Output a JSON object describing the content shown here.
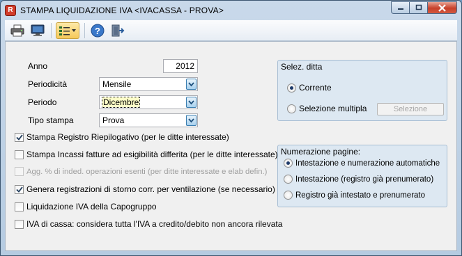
{
  "window": {
    "title": "STAMPA LIQUIDAZIONE IVA <IVACASSA - PROVA>",
    "app_icon_letter": "R"
  },
  "toolbar": {
    "buttons": [
      "printer-icon",
      "monitor-icon",
      "list-options-icon",
      "help-icon",
      "exit-door-icon"
    ]
  },
  "form": {
    "anno_label": "Anno",
    "anno_value": "2012",
    "periodicita_label": "Periodicità",
    "periodicita_value": "Mensile",
    "periodo_label": "Periodo",
    "periodo_value": "Dicembre",
    "tipo_stampa_label": "Tipo stampa",
    "tipo_stampa_value": "Prova"
  },
  "options": [
    {
      "label": "Stampa Registro Riepilogativo (per le ditte interessate)",
      "checked": true,
      "enabled": true
    },
    {
      "label": "Stampa Incassi fatture ad esigibilità differita (per le ditte interessate)",
      "checked": false,
      "enabled": true
    },
    {
      "label": "Agg. % di inded. operazioni esenti (per ditte interessate e elab defin.)",
      "checked": false,
      "enabled": false
    },
    {
      "label": "Genera registrazioni di storno corr. per ventilazione (se necessario)",
      "checked": true,
      "enabled": true
    },
    {
      "label": "Liquidazione IVA della Capogruppo",
      "checked": false,
      "enabled": true
    },
    {
      "label": "IVA di cassa: considera tutta l'IVA a credito/debito non ancora rilevata",
      "checked": false,
      "enabled": true
    }
  ],
  "selez_ditta": {
    "title": "Selez. ditta",
    "corrente_label": "Corrente",
    "multipla_label": "Selezione multipla",
    "selezione_button": "Selezione",
    "selected": "corrente"
  },
  "numerazione": {
    "title": "Numerazione pagine:",
    "options": [
      "Intestazione e numerazione automatiche",
      "Intestazione (registro già prenumerato)",
      "Registro già intestato e prenumerato"
    ],
    "selected_index": 0
  },
  "colors": {
    "accent": "#3c7fb1",
    "close_button": "#c7402a",
    "group_bg": "#dde8f2"
  }
}
